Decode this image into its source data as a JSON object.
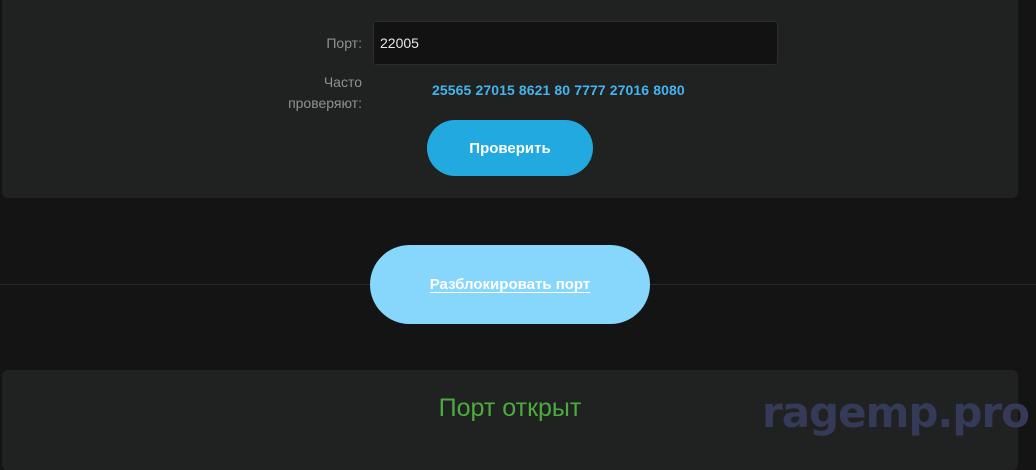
{
  "checker": {
    "port_label": "Порт:",
    "port_value": "22005",
    "common_label_line1": "Часто",
    "common_label_line2": "проверяют:",
    "common_ports": [
      "25565",
      "27015",
      "8621",
      "80",
      "7777",
      "27016",
      "8080"
    ],
    "check_button": "Проверить"
  },
  "unblock_button": "Разблокировать порт",
  "result": {
    "status_text": "Порт открыт",
    "status_color": "#4cab3d"
  },
  "watermark": "ragemp.pro",
  "colors": {
    "accent": "#22a9e0",
    "accent_light": "#87d6fb",
    "link": "#45b4ec"
  }
}
